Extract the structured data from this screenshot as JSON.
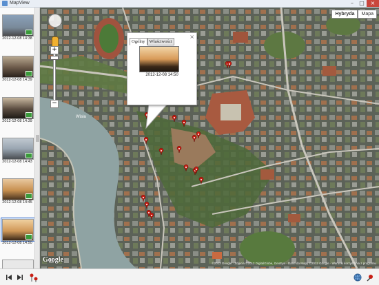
{
  "window": {
    "title": "MapView",
    "minimize": "–",
    "maximize": "□",
    "close": "×"
  },
  "thumbnails": [
    {
      "caption": "2012-12-08 14:38",
      "tone": "#7a8a9a"
    },
    {
      "caption": "2012-12-08 14:39",
      "tone": "#6a5848"
    },
    {
      "caption": "2012-12-08 14:39",
      "tone": "#5a4c40"
    },
    {
      "caption": "2012-12-08 14:43",
      "tone": "#9aa6b2"
    },
    {
      "caption": "2012-12-08 14:45",
      "tone": "#c89050"
    },
    {
      "caption": "2012-12-08 14:50",
      "tone": "#d09858",
      "selected": true
    }
  ],
  "map_type": {
    "hybrid_label": "Hybryda",
    "map_label": "Mapa"
  },
  "popup": {
    "tab_general": "Ogólny",
    "tab_properties": "Właściwości",
    "date": "2012-12-08 14:50",
    "close": "×"
  },
  "map_credits": {
    "logo": "Google",
    "copyright": "©2012 Google · Zdjęcia ©2012 DigitalGlobe, GeoEye · Dane do Mapy ©2012 Google · Warunki korzystania z programu"
  },
  "map_labels": {
    "river": "Wisła"
  },
  "controls": {
    "zoom_in": "+",
    "zoom_out": "−"
  },
  "colors": {
    "marker": "#c81e14",
    "water": "#8fa3a3",
    "accent": "#4a7bd0"
  }
}
